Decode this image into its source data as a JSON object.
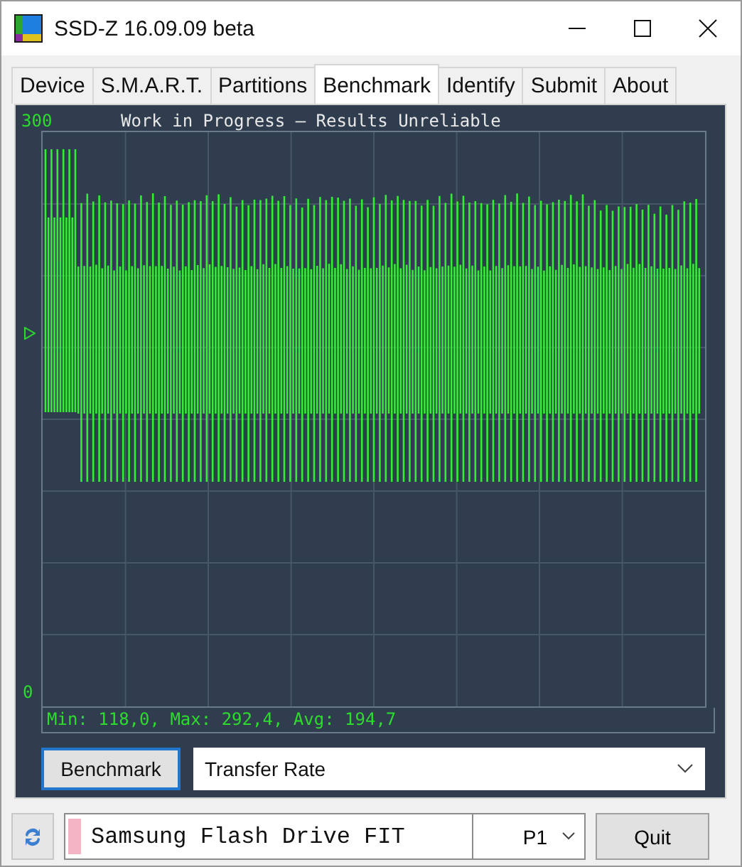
{
  "window": {
    "title": "SSD-Z 16.09.09 beta"
  },
  "tabs": [
    {
      "label": "Device",
      "selected": false
    },
    {
      "label": "S.M.A.R.T.",
      "selected": false
    },
    {
      "label": "Partitions",
      "selected": false
    },
    {
      "label": "Benchmark",
      "selected": true
    },
    {
      "label": "Identify",
      "selected": false
    },
    {
      "label": "Submit",
      "selected": false
    },
    {
      "label": "About",
      "selected": false
    }
  ],
  "chart": {
    "scale_max": "300",
    "scale_min": "0",
    "banner": "Work in Progress – Results Unreliable",
    "stats": "Min: 118,0, Max: 292,4, Avg: 194,7"
  },
  "controls": {
    "button": "Benchmark",
    "mode": "Transfer Rate"
  },
  "status": {
    "drive": "Samsung Flash Drive FIT",
    "port": "P1",
    "quit": "Quit"
  }
}
